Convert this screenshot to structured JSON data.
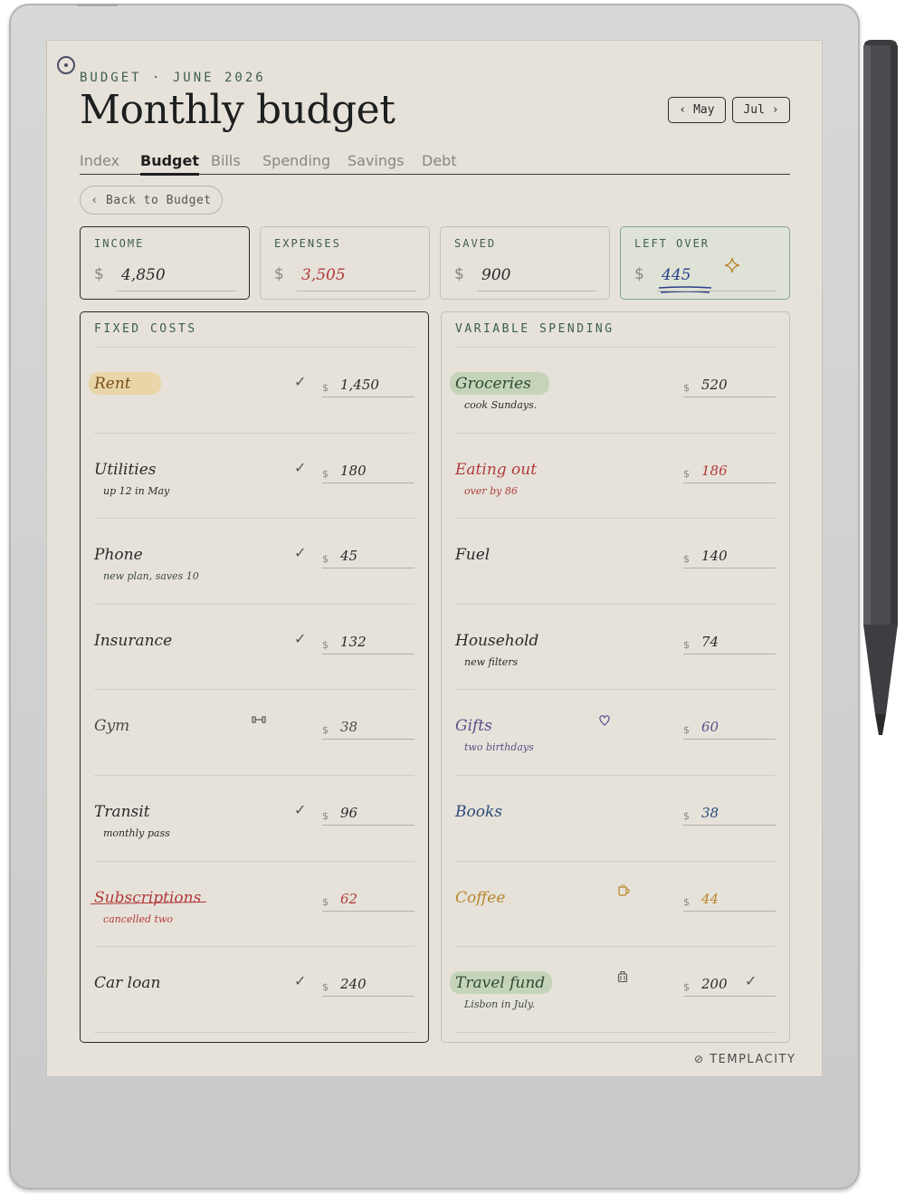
{
  "header": {
    "eyebrow": "BUDGET · JUNE 2026",
    "title": "Monthly budget",
    "prev_label": "‹ May",
    "next_label": "Jul ›"
  },
  "tabs": [
    {
      "label": "Index"
    },
    {
      "label": "Budget",
      "active": true
    },
    {
      "label": "Bills"
    },
    {
      "label": "Spending"
    },
    {
      "label": "Savings"
    },
    {
      "label": "Debt"
    }
  ],
  "back_label": "‹ Back to Budget",
  "summary": {
    "currency": "$",
    "income": {
      "label": "INCOME",
      "value": "4,850"
    },
    "expenses": {
      "label": "EXPENSES",
      "value": "3,505"
    },
    "saved": {
      "label": "SAVED",
      "value": "900"
    },
    "left_over": {
      "label": "LEFT OVER",
      "value": "445"
    }
  },
  "fixed": {
    "title": "FIXED COSTS",
    "rows": [
      {
        "label": "Rent",
        "note": "",
        "amount": "1,450",
        "paid": true,
        "highlight": "#e9d6a8",
        "color": "#2a2a2a"
      },
      {
        "label": "Utilities",
        "note": "up 12 in May",
        "amount": "180",
        "paid": true,
        "color": "#2a2a2a"
      },
      {
        "label": "Phone",
        "note": "new plan, saves 10",
        "amount": "45",
        "paid": true,
        "color": "#2a2a2a"
      },
      {
        "label": "Insurance",
        "note": "",
        "amount": "132",
        "paid": true,
        "color": "#2a2a2a"
      },
      {
        "label": "Gym",
        "note": "",
        "amount": "38",
        "paid": false,
        "icon": "dumbbell-icon",
        "color": "#4a4a4a"
      },
      {
        "label": "Transit",
        "note": "monthly pass",
        "amount": "96",
        "paid": true,
        "color": "#2a2a2a"
      },
      {
        "label": "Subscriptions",
        "note": "cancelled two",
        "amount": "62",
        "paid": false,
        "struck": true,
        "color": "#b23a3a"
      },
      {
        "label": "Car loan",
        "note": "",
        "amount": "240",
        "paid": true,
        "color": "#2a2a2a"
      }
    ]
  },
  "variable": {
    "title": "VARIABLE SPENDING",
    "rows": [
      {
        "label": "Groceries",
        "note": "cook Sundays.",
        "amount": "520",
        "highlight": "#c5d4b9",
        "color": "#2a2a2a"
      },
      {
        "label": "Eating out",
        "note": "over by 86",
        "amount": "186",
        "color": "#b23a3a"
      },
      {
        "label": "Fuel",
        "note": "",
        "amount": "140",
        "color": "#2a2a2a"
      },
      {
        "label": "Household",
        "note": "new filters",
        "amount": "74",
        "color": "#2a2a2a"
      },
      {
        "label": "Gifts",
        "note": "two birthdays",
        "amount": "60",
        "icon": "heart-icon",
        "color": "#5a4e8a"
      },
      {
        "label": "Books",
        "note": "",
        "amount": "38",
        "color": "#2b4a7a"
      },
      {
        "label": "Coffee",
        "note": "",
        "amount": "44",
        "icon": "coffee-cup-icon",
        "color": "#b8862a"
      },
      {
        "label": "Travel fund",
        "note": "Lisbon in July.",
        "amount": "200",
        "icon": "suitcase-icon",
        "paid": true,
        "highlight": "#c5d4b9",
        "color": "#2a2a2a"
      }
    ]
  },
  "brand": "TEMPLACITY",
  "colors": {
    "paper": "#e6e2da",
    "accent_green": "#3e5e4c",
    "red": "#b23a3a",
    "blue": "#2b3f8a"
  }
}
